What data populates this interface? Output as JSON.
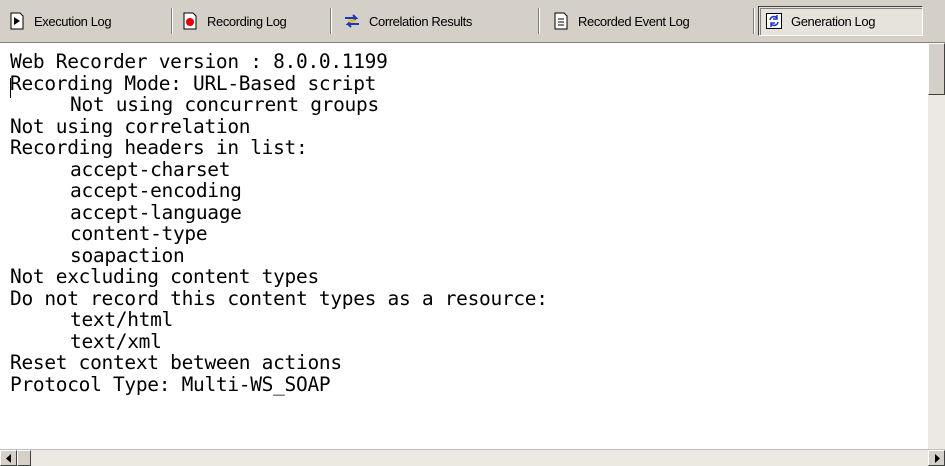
{
  "tabs": [
    {
      "label": "Execution Log",
      "icon": "play-page-icon",
      "active": false
    },
    {
      "label": "Recording Log",
      "icon": "record-page-icon",
      "active": false
    },
    {
      "label": "Correlation Results",
      "icon": "swap-arrows-icon",
      "active": false
    },
    {
      "label": "Recorded Event Log",
      "icon": "document-icon",
      "active": false
    },
    {
      "label": "Generation Log",
      "icon": "refresh-page-icon",
      "active": true
    }
  ],
  "log": {
    "lines": [
      {
        "text": "Web Recorder version : 8.0.0.1199",
        "indent": 0
      },
      {
        "text": "Recording Mode: URL-Based script",
        "indent": 0
      },
      {
        "text": "Not using concurrent groups",
        "indent": 1
      },
      {
        "text": "Not using correlation",
        "indent": 0
      },
      {
        "text": "Recording headers in list:",
        "indent": 0
      },
      {
        "text": "accept-charset",
        "indent": 1
      },
      {
        "text": "accept-encoding",
        "indent": 1
      },
      {
        "text": "accept-language",
        "indent": 1
      },
      {
        "text": "content-type",
        "indent": 1
      },
      {
        "text": "soapaction",
        "indent": 1
      },
      {
        "text": "Not excluding content types",
        "indent": 0
      },
      {
        "text": "Do not record this content types as a resource:",
        "indent": 0
      },
      {
        "text": "text/html",
        "indent": 1
      },
      {
        "text": "text/xml",
        "indent": 1
      },
      {
        "text": "Reset context between actions",
        "indent": 0
      },
      {
        "text": "Protocol Type: Multi-WS_SOAP",
        "indent": 0
      }
    ]
  },
  "colors": {
    "chrome": "#d4d0c8",
    "record_red": "#e00000",
    "correlation_blue": "#1a36c8",
    "correlation_yellow": "#e8c400"
  }
}
